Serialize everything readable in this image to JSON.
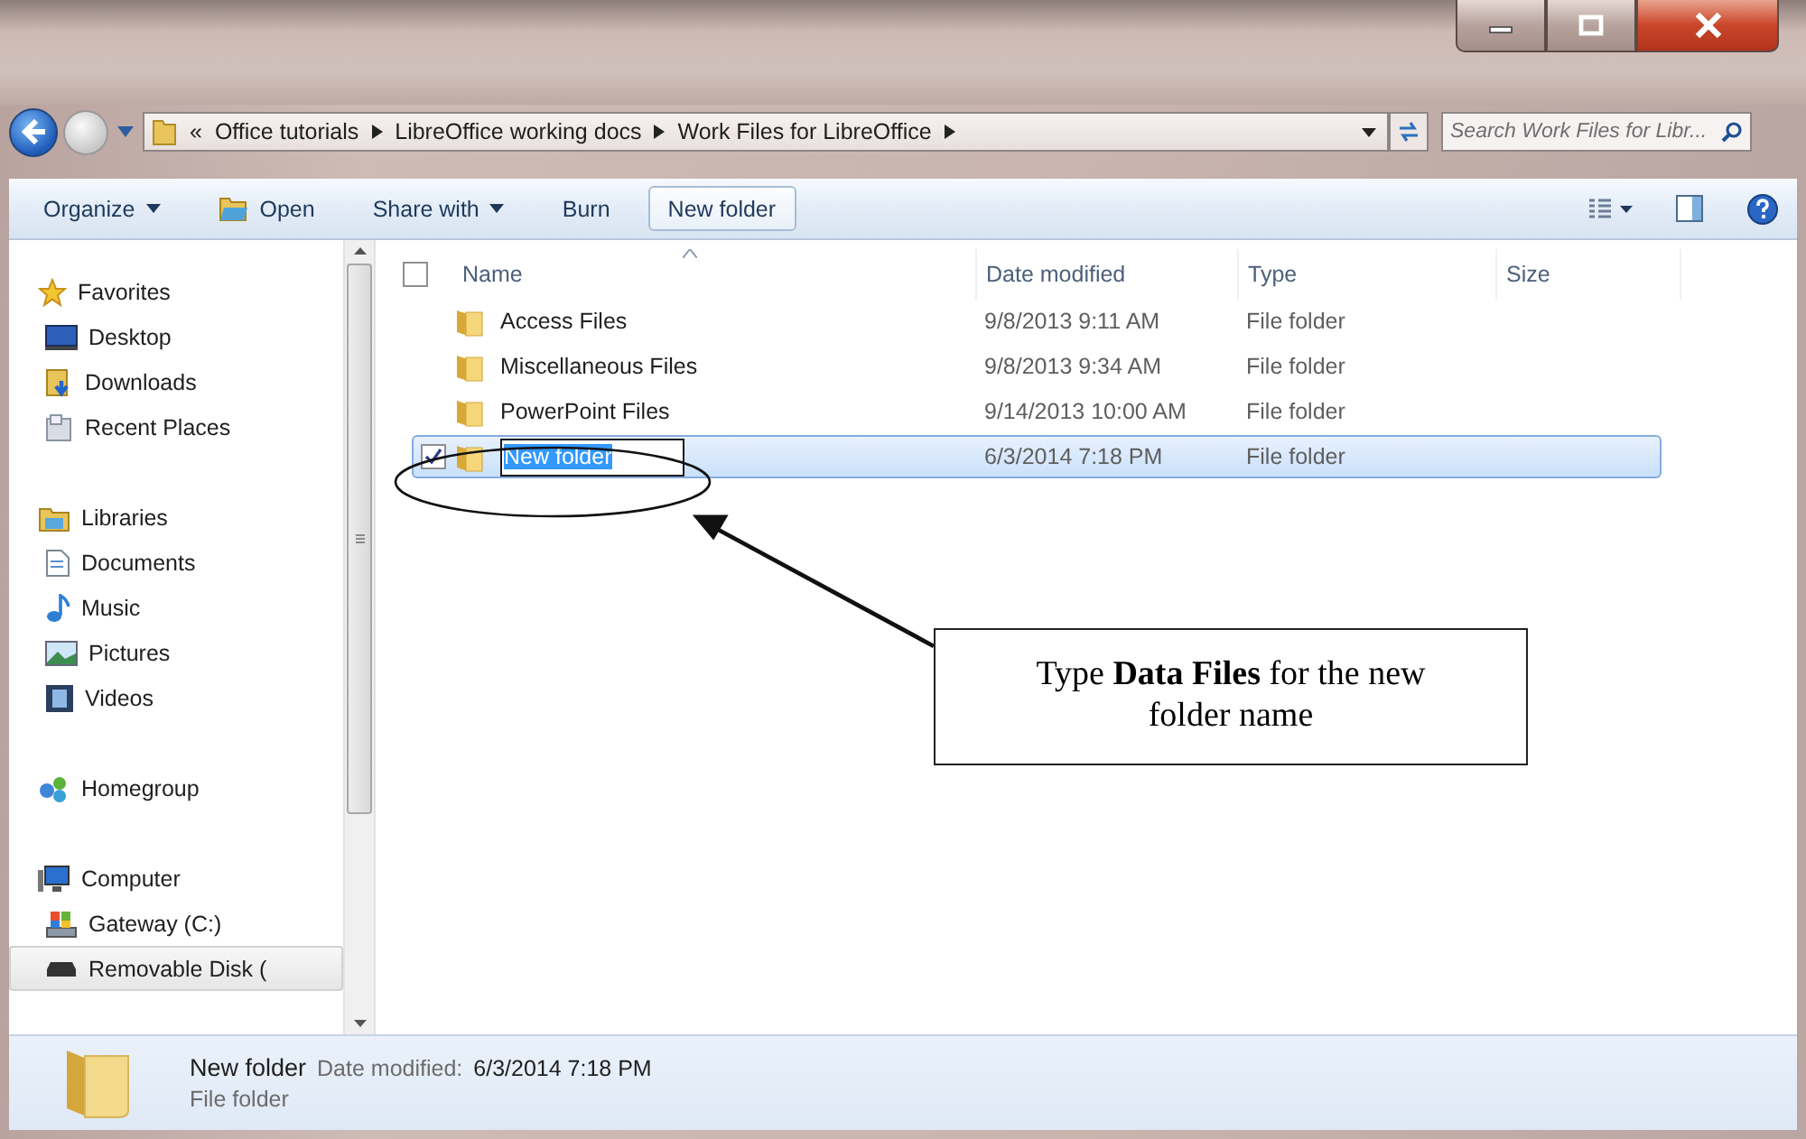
{
  "address_bar": {
    "overflow": "«",
    "crumbs": [
      "Office tutorials",
      "LibreOffice working docs",
      "Work Files for LibreOffice"
    ]
  },
  "search": {
    "placeholder": "Search Work Files for Libr..."
  },
  "toolbar": {
    "buttons": [
      {
        "label": "Organize",
        "dropdown": true,
        "has_icon": false,
        "highlighted": false
      },
      {
        "label": "Open",
        "dropdown": false,
        "has_icon": true,
        "highlighted": false
      },
      {
        "label": "Share with",
        "dropdown": true,
        "has_icon": false,
        "highlighted": false
      },
      {
        "label": "Burn",
        "dropdown": false,
        "has_icon": false,
        "highlighted": false
      },
      {
        "label": "New folder",
        "dropdown": false,
        "has_icon": false,
        "highlighted": true
      }
    ]
  },
  "sidebar": {
    "groups": [
      {
        "label": "Favorites",
        "selected": false,
        "children": [
          {
            "label": "Desktop",
            "selected": false
          },
          {
            "label": "Downloads",
            "selected": false
          },
          {
            "label": "Recent Places",
            "selected": false
          }
        ]
      },
      {
        "label": "Libraries",
        "selected": false,
        "children": [
          {
            "label": "Documents",
            "selected": false
          },
          {
            "label": "Music",
            "selected": false
          },
          {
            "label": "Pictures",
            "selected": false
          },
          {
            "label": "Videos",
            "selected": false
          }
        ]
      },
      {
        "label": "Homegroup",
        "selected": false
      },
      {
        "label": "Computer",
        "selected": false,
        "children": [
          {
            "label": "Gateway (C:)",
            "selected": false
          },
          {
            "label": "Removable Disk (",
            "selected": true
          }
        ]
      }
    ]
  },
  "file_list": {
    "select_all_checked": false,
    "columns": [
      "Name",
      "Date modified",
      "Type",
      "Size"
    ],
    "rows": [
      {
        "name": "Access Files",
        "date": "9/8/2013 9:11 AM",
        "type": "File folder",
        "selected": false,
        "checked": false,
        "editing": false
      },
      {
        "name": "Miscellaneous Files",
        "date": "9/8/2013 9:34 AM",
        "type": "File folder",
        "selected": false,
        "checked": false,
        "editing": false
      },
      {
        "name": "PowerPoint Files",
        "date": "9/14/2013 10:00 AM",
        "type": "File folder",
        "selected": false,
        "checked": false,
        "editing": false
      },
      {
        "name": "New folder",
        "date": "6/3/2014 7:18 PM",
        "type": "File folder",
        "selected": true,
        "checked": true,
        "editing": true
      }
    ]
  },
  "details": {
    "name": "New folder",
    "date_label": "Date modified:",
    "date": "6/3/2014 7:18 PM",
    "type": "File folder"
  },
  "callout": {
    "text": "Type **Data Files** for the new folder name"
  }
}
